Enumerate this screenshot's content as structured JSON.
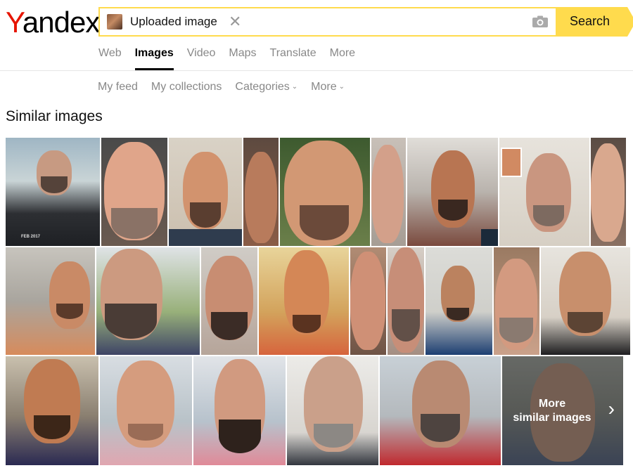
{
  "logo": {
    "first": "Y",
    "rest": "andex"
  },
  "search": {
    "chip_label": "Uploaded image",
    "close_glyph": "✕",
    "button_label": "Search",
    "accent": "#ffdb4d"
  },
  "tabs": [
    {
      "label": "Web",
      "active": false
    },
    {
      "label": "Images",
      "active": true
    },
    {
      "label": "Video",
      "active": false
    },
    {
      "label": "Maps",
      "active": false
    },
    {
      "label": "Translate",
      "active": false
    },
    {
      "label": "More",
      "active": false
    }
  ],
  "subnav": [
    {
      "label": "My feed",
      "caret": false
    },
    {
      "label": "My collections",
      "caret": false
    },
    {
      "label": "Categories",
      "caret": true
    },
    {
      "label": "More",
      "caret": true
    }
  ],
  "section_title": "Similar images",
  "more_tile": {
    "line1": "More",
    "line2": "similar images",
    "chevron": "›"
  },
  "thumb_labels": {
    "date_stamp": "FEB 2017"
  }
}
